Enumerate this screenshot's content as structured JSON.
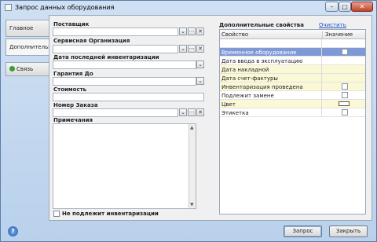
{
  "window": {
    "title": "Запрос данных оборудования",
    "min": "–",
    "max": "□",
    "close": "✕"
  },
  "tabs": [
    "Главное",
    "Дополнительно",
    "Связь"
  ],
  "form": {
    "supplier_label": "Поставщик",
    "service_org_label": "Сервисная Организация",
    "last_inventory_label": "Дата последней инвентаризации",
    "warranty_label": "Гарантия До",
    "cost_label": "Стоимость",
    "order_label": "Номер Заказа",
    "notes_label": "Примечания",
    "no_inventory_label": "Не подлежит инвентаризации"
  },
  "props": {
    "title": "Дополнительные свойства",
    "clear_link": "Очистить текущее",
    "col_property": "Свойство",
    "col_value": "Значение",
    "rows": [
      {
        "name": "",
        "kind": "none",
        "style": ""
      },
      {
        "name": "Временное оборудование",
        "kind": "check",
        "style": "sel"
      },
      {
        "name": "Дата ввода в эксплуатацию",
        "kind": "none",
        "style": ""
      },
      {
        "name": "Дата накладной",
        "kind": "none",
        "style": "yel"
      },
      {
        "name": "Дата счет-фактуры",
        "kind": "none",
        "style": "yel"
      },
      {
        "name": "Инвентаризация проведена",
        "kind": "check",
        "style": "yel"
      },
      {
        "name": "Подлежит замене",
        "kind": "check",
        "style": ""
      },
      {
        "name": "Цвет",
        "kind": "color",
        "style": "yel"
      },
      {
        "name": "Этикетка",
        "kind": "check",
        "style": ""
      }
    ]
  },
  "footer": {
    "help": "?",
    "request_button": "Запрос",
    "close_button": "Закрыть"
  },
  "glyphs": {
    "dropdown": "⌄",
    "browse": "···",
    "clear": "✕",
    "up": "▲",
    "down": "▼"
  }
}
